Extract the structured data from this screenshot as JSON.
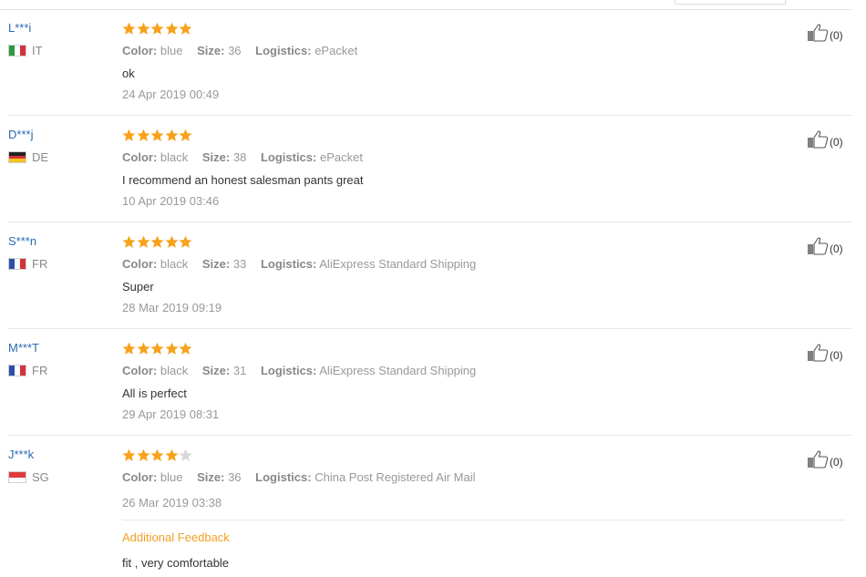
{
  "labels": {
    "color": "Color:",
    "size": "Size:",
    "logistics": "Logistics:"
  },
  "reviews": [
    {
      "user": "L***i",
      "country": "IT",
      "rating": 5,
      "color": "blue",
      "size": "36",
      "logistics": "ePacket",
      "text": "ok",
      "date": "24 Apr 2019 00:49",
      "likes": "(0)"
    },
    {
      "user": "D***j",
      "country": "DE",
      "rating": 5,
      "color": "black",
      "size": "38",
      "logistics": "ePacket",
      "text": "I recommend an honest salesman pants great",
      "date": "10 Apr 2019 03:46",
      "likes": "(0)"
    },
    {
      "user": "S***n",
      "country": "FR",
      "rating": 5,
      "color": "black",
      "size": "33",
      "logistics": "AliExpress Standard Shipping",
      "text": "Super",
      "date": "28 Mar 2019 09:19",
      "likes": "(0)"
    },
    {
      "user": "M***T",
      "country": "FR",
      "rating": 5,
      "color": "black",
      "size": "31",
      "logistics": "AliExpress Standard Shipping",
      "text": "All is perfect",
      "date": "29 Apr 2019 08:31",
      "likes": "(0)"
    },
    {
      "user": "J***k",
      "country": "SG",
      "rating": 4,
      "color": "blue",
      "size": "36",
      "logistics": "China Post Registered Air Mail",
      "text": "",
      "date": "26 Mar 2019 03:38",
      "likes": "(0)",
      "additional_feedback": {
        "title": "Additional Feedback",
        "text": "fit , very comfortable"
      }
    }
  ],
  "colors": {
    "username": "#2b6ab1",
    "star_on": "#f7a21b",
    "star_off": "#d8d8d8",
    "feedback_title": "#f2a024"
  },
  "icons": {
    "like": "thumbs-up-icon",
    "star": "star-icon"
  }
}
